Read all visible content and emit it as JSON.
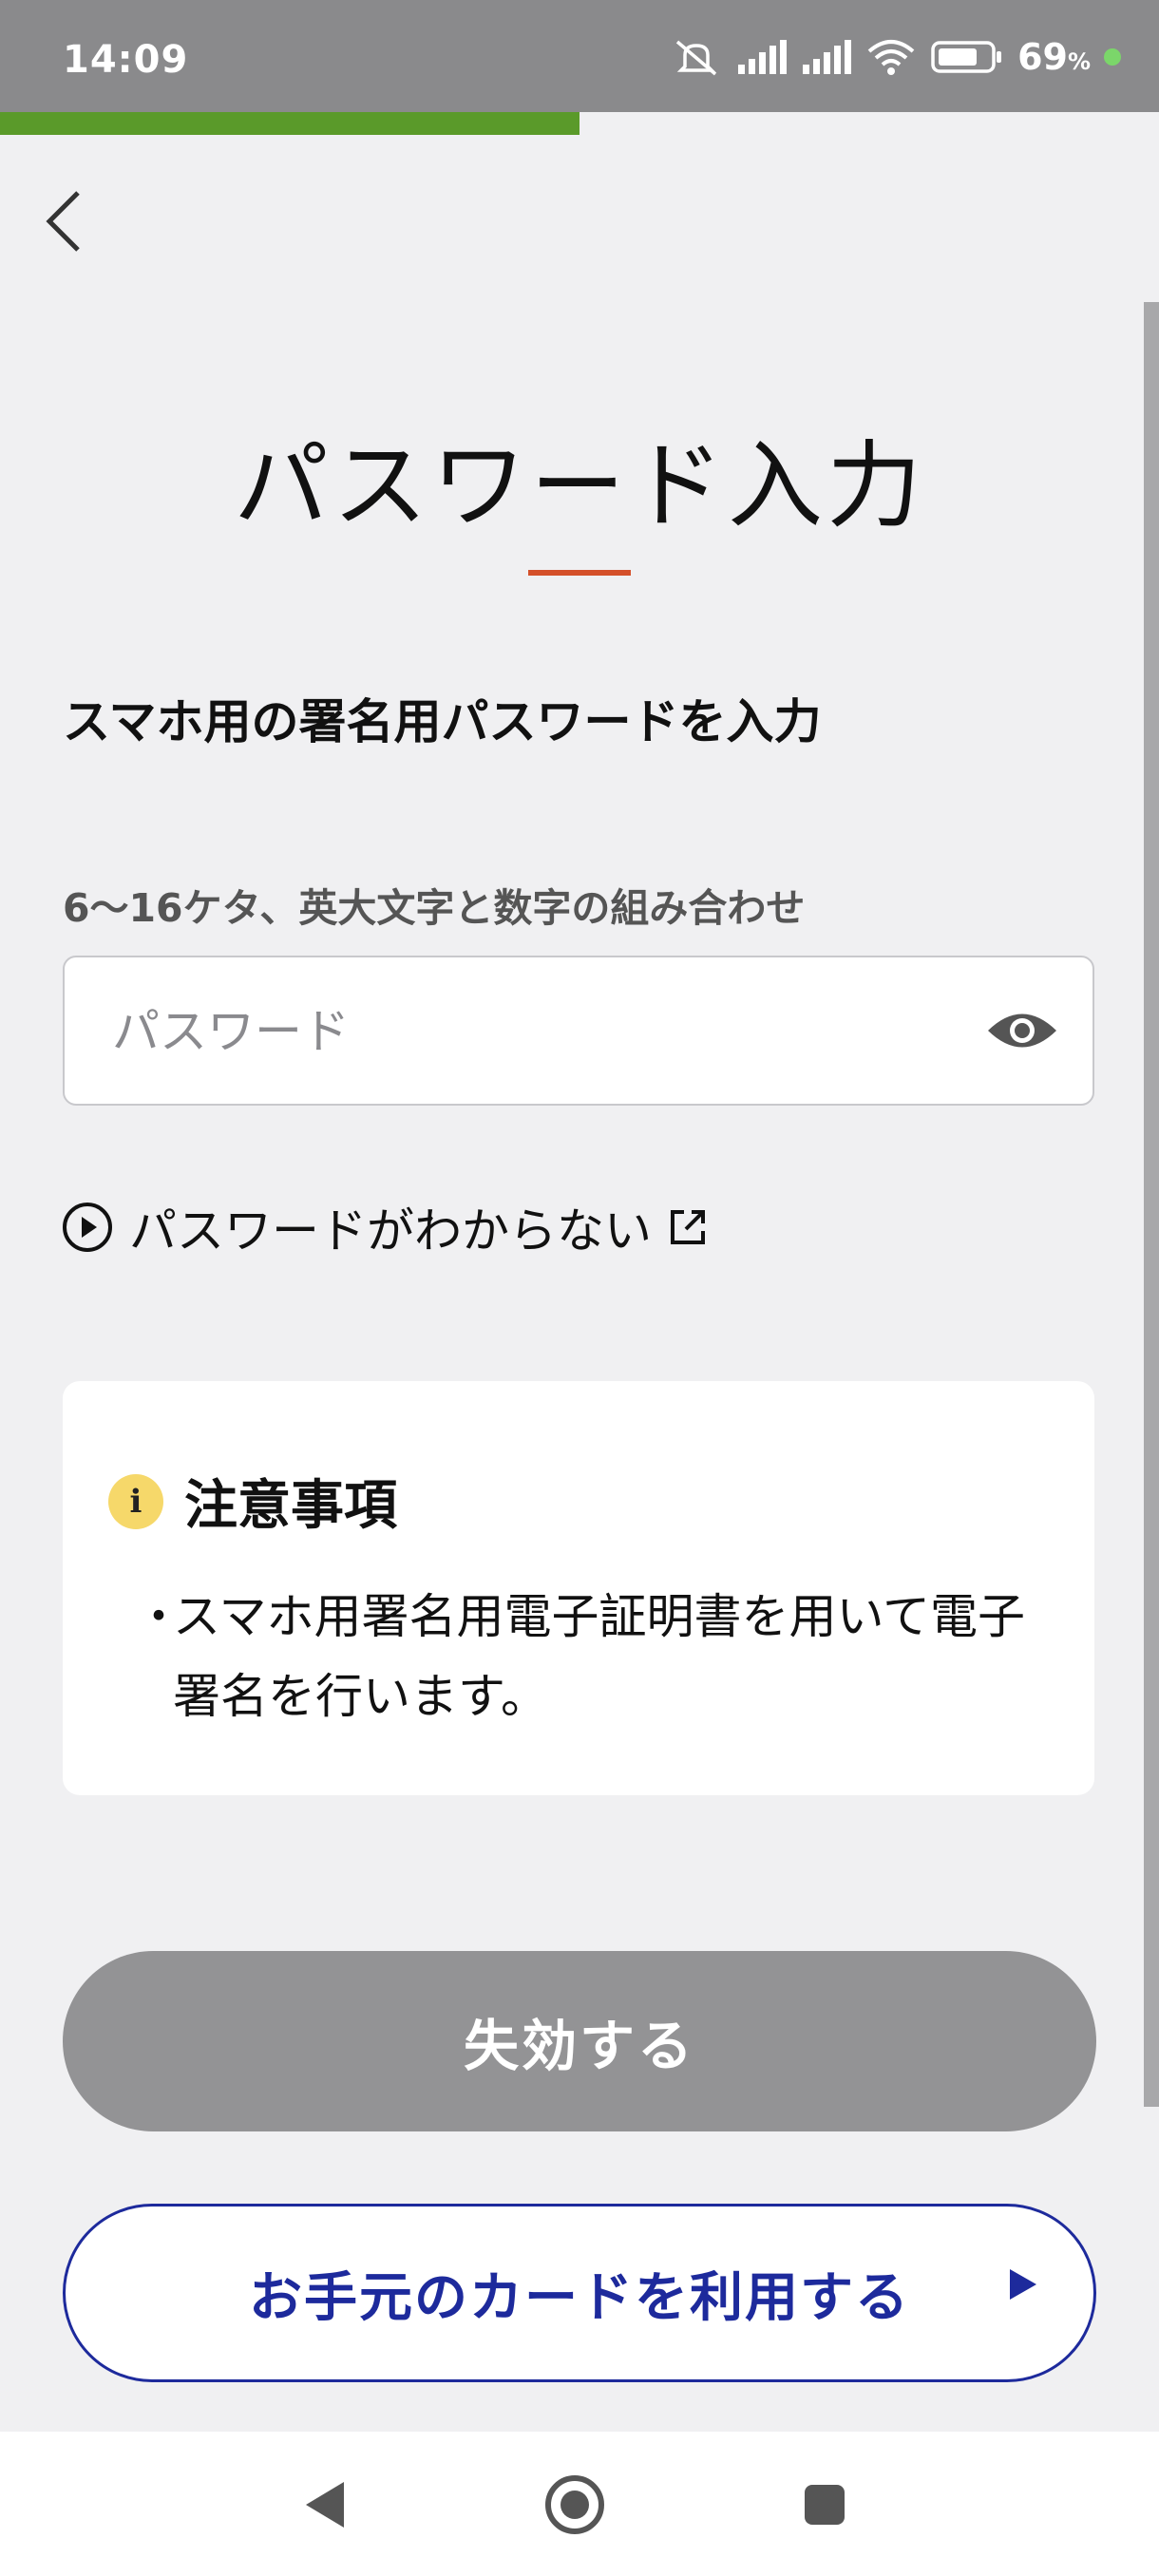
{
  "status_bar": {
    "time": "14:09",
    "battery": "69",
    "battery_unit": "%"
  },
  "progress": {
    "fraction": 0.5
  },
  "header": {
    "back_icon": "chevron-left-icon"
  },
  "page": {
    "title": "パスワード入力",
    "subtitle": "スマホ用の署名用パスワードを入力",
    "hint": "6〜16ケタ、英大文字と数字の組み合わせ"
  },
  "password": {
    "placeholder": "パスワード",
    "value": "",
    "toggle_icon": "eye-icon"
  },
  "help_link": {
    "label": "パスワードがわからない",
    "icon": "play-circle-icon",
    "external_icon": "external-link-icon"
  },
  "notice": {
    "icon": "info-icon",
    "icon_glyph": "i",
    "title": "注意事項",
    "bullet": "・",
    "text": "スマホ用署名用電子証明書を用いて電子署名を行います。"
  },
  "buttons": {
    "disabled_label": "失効する",
    "card_label": "お手元のカードを利用する",
    "card_arrow_icon": "triangle-right-icon"
  },
  "nav": {
    "back": "nav-back-icon",
    "home": "nav-home-icon",
    "recents": "nav-recents-icon"
  },
  "colors": {
    "accent_green": "#5a9a2a",
    "title_underline": "#d4502a",
    "primary_blue": "#1d2a9c",
    "disabled_gray": "#939395"
  }
}
